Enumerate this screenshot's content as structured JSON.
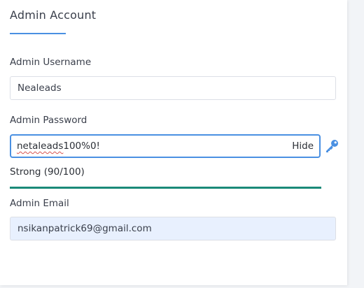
{
  "section": {
    "title": "Admin Account"
  },
  "username": {
    "label": "Admin Username",
    "value": "Nealeads"
  },
  "password": {
    "label": "Admin Password",
    "value_word": "netaleads",
    "value_rest": "100%0!",
    "toggle_label": "Hide"
  },
  "strength": {
    "text": "Strong (90/100)",
    "score": 90,
    "max": 100,
    "color": "#1a8a78"
  },
  "email": {
    "label": "Admin Email",
    "value": "nsikanpatrick69@gmail.com"
  },
  "icons": {
    "generate_password": "key-icon"
  },
  "colors": {
    "accent": "#4a90e2",
    "autofill_bg": "#e8f0fe"
  }
}
